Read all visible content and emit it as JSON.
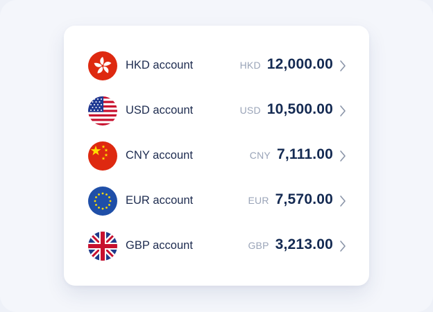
{
  "accounts": [
    {
      "name": "HKD account",
      "currency": "HKD",
      "amount": "12,000.00",
      "flag": "hong-kong-flag-icon"
    },
    {
      "name": "USD account",
      "currency": "USD",
      "amount": "10,500.00",
      "flag": "united-states-flag-icon"
    },
    {
      "name": "CNY account",
      "currency": "CNY",
      "amount": "7,111.00",
      "flag": "china-flag-icon"
    },
    {
      "name": "EUR account",
      "currency": "EUR",
      "amount": "7,570.00",
      "flag": "european-union-flag-icon"
    },
    {
      "name": "GBP account",
      "currency": "GBP",
      "amount": "3,213.00",
      "flag": "united-kingdom-flag-icon"
    }
  ],
  "colors": {
    "text_primary": "#1d2b4f",
    "amount": "#142a52",
    "currency": "#9aa4b8",
    "chevron": "#8a94a8",
    "card_bg": "#ffffff",
    "page_bg": "#f4f6fb"
  },
  "icons": {
    "row_action": "chevron-right-icon"
  }
}
